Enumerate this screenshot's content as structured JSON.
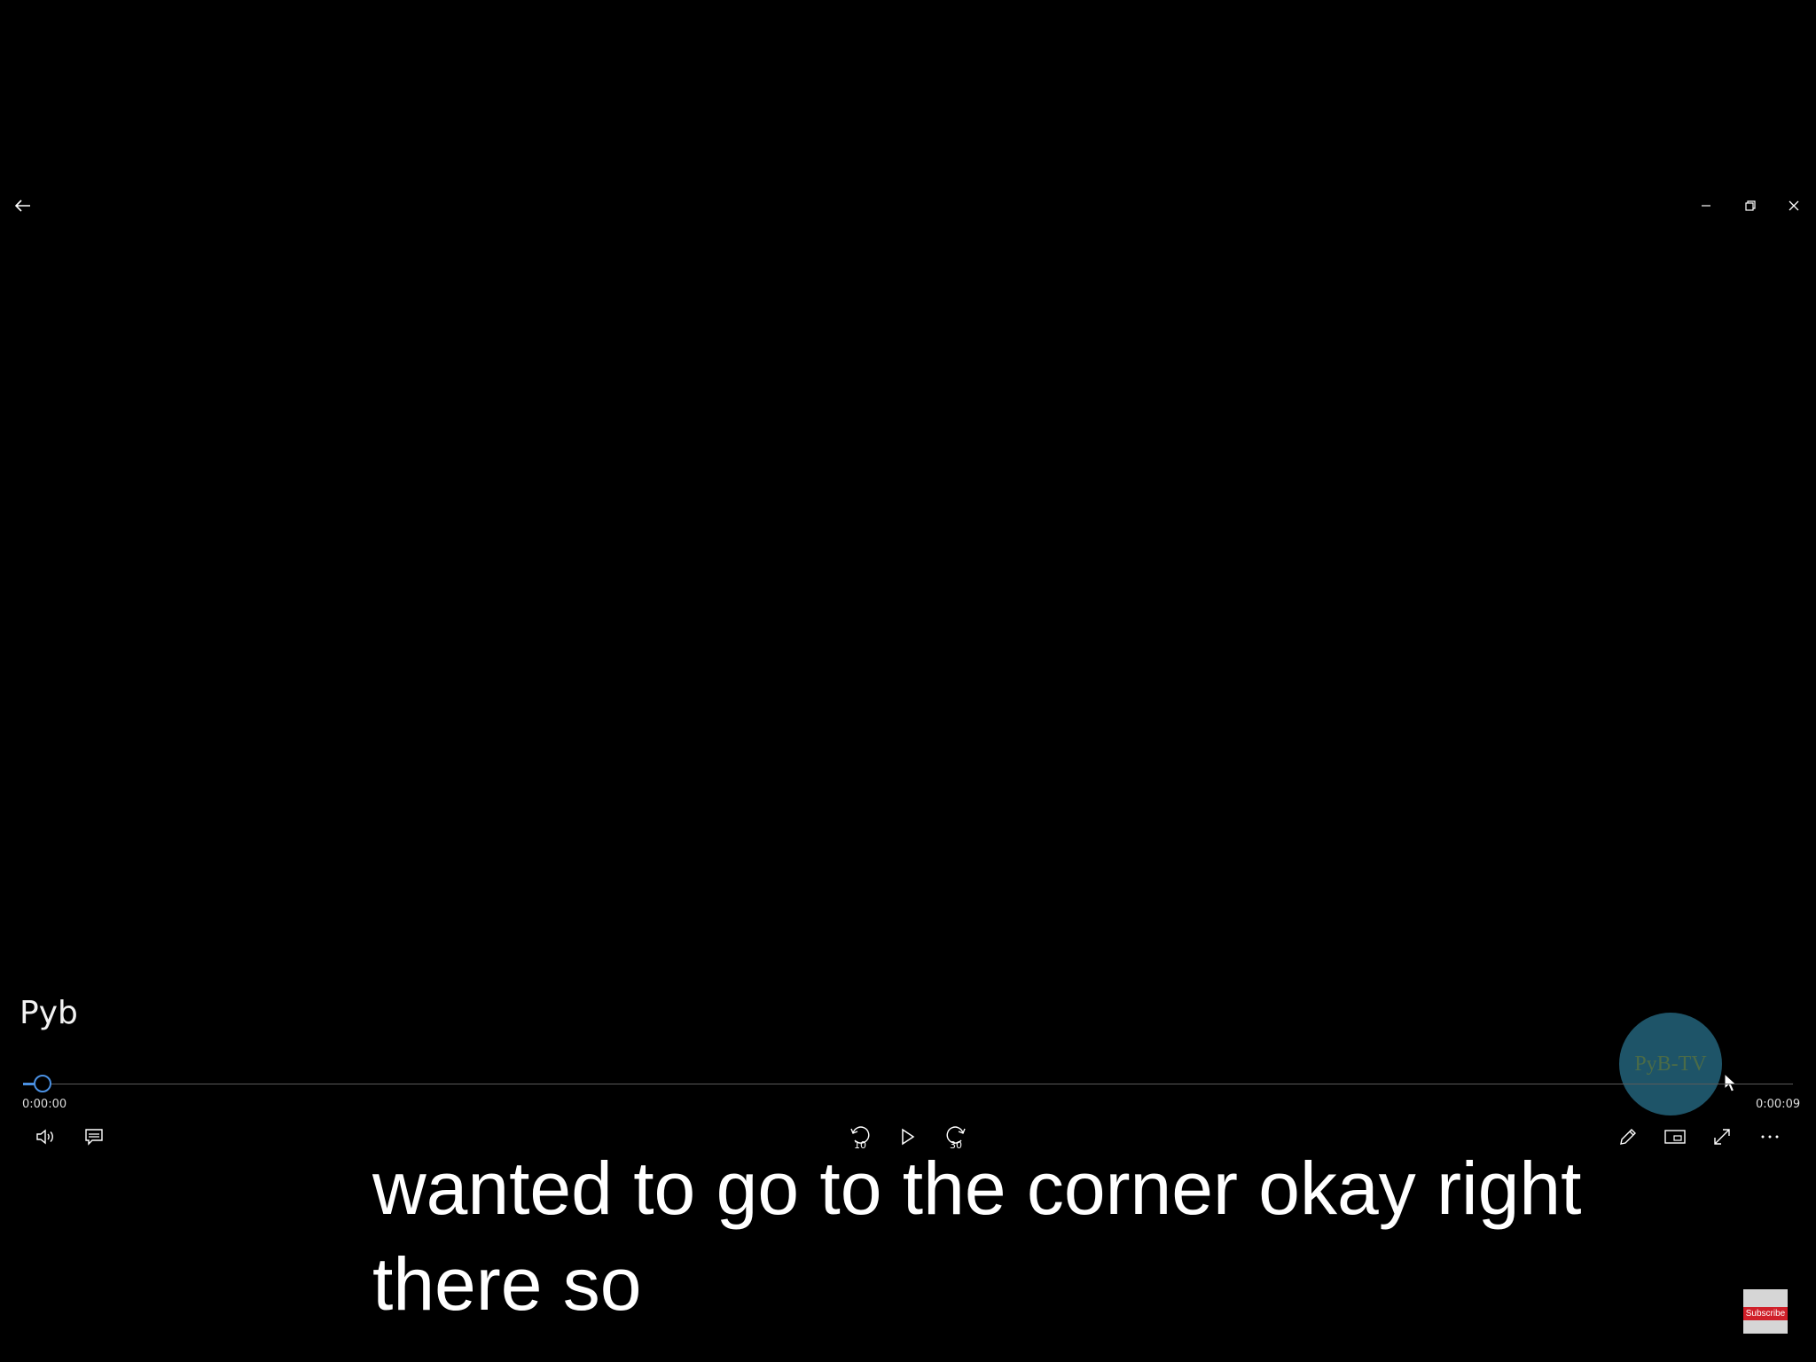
{
  "media": {
    "title": "Pyb",
    "current_time": "0:00:00",
    "duration": "0:00:09",
    "progress": 0.0
  },
  "caption": {
    "line1": "wanted to go to the corner okay right",
    "line2": "there so"
  },
  "controls": {
    "skip_back_seconds": "10",
    "skip_forward_seconds": "30"
  },
  "overlay": {
    "watermark_text": "PyB-TV",
    "subscribe_label": "Subscribe"
  },
  "colors": {
    "background": "#000000",
    "accent": "#4a90e2",
    "watermark": "#1e5468",
    "subscribe": "#d0202a"
  },
  "icons": [
    "back-arrow-icon",
    "minimize-icon",
    "restore-icon",
    "close-icon",
    "volume-icon",
    "captions-icon",
    "skip-back-icon",
    "play-icon",
    "skip-forward-icon",
    "edit-icon",
    "mini-view-icon",
    "fullscreen-icon",
    "more-icon"
  ]
}
